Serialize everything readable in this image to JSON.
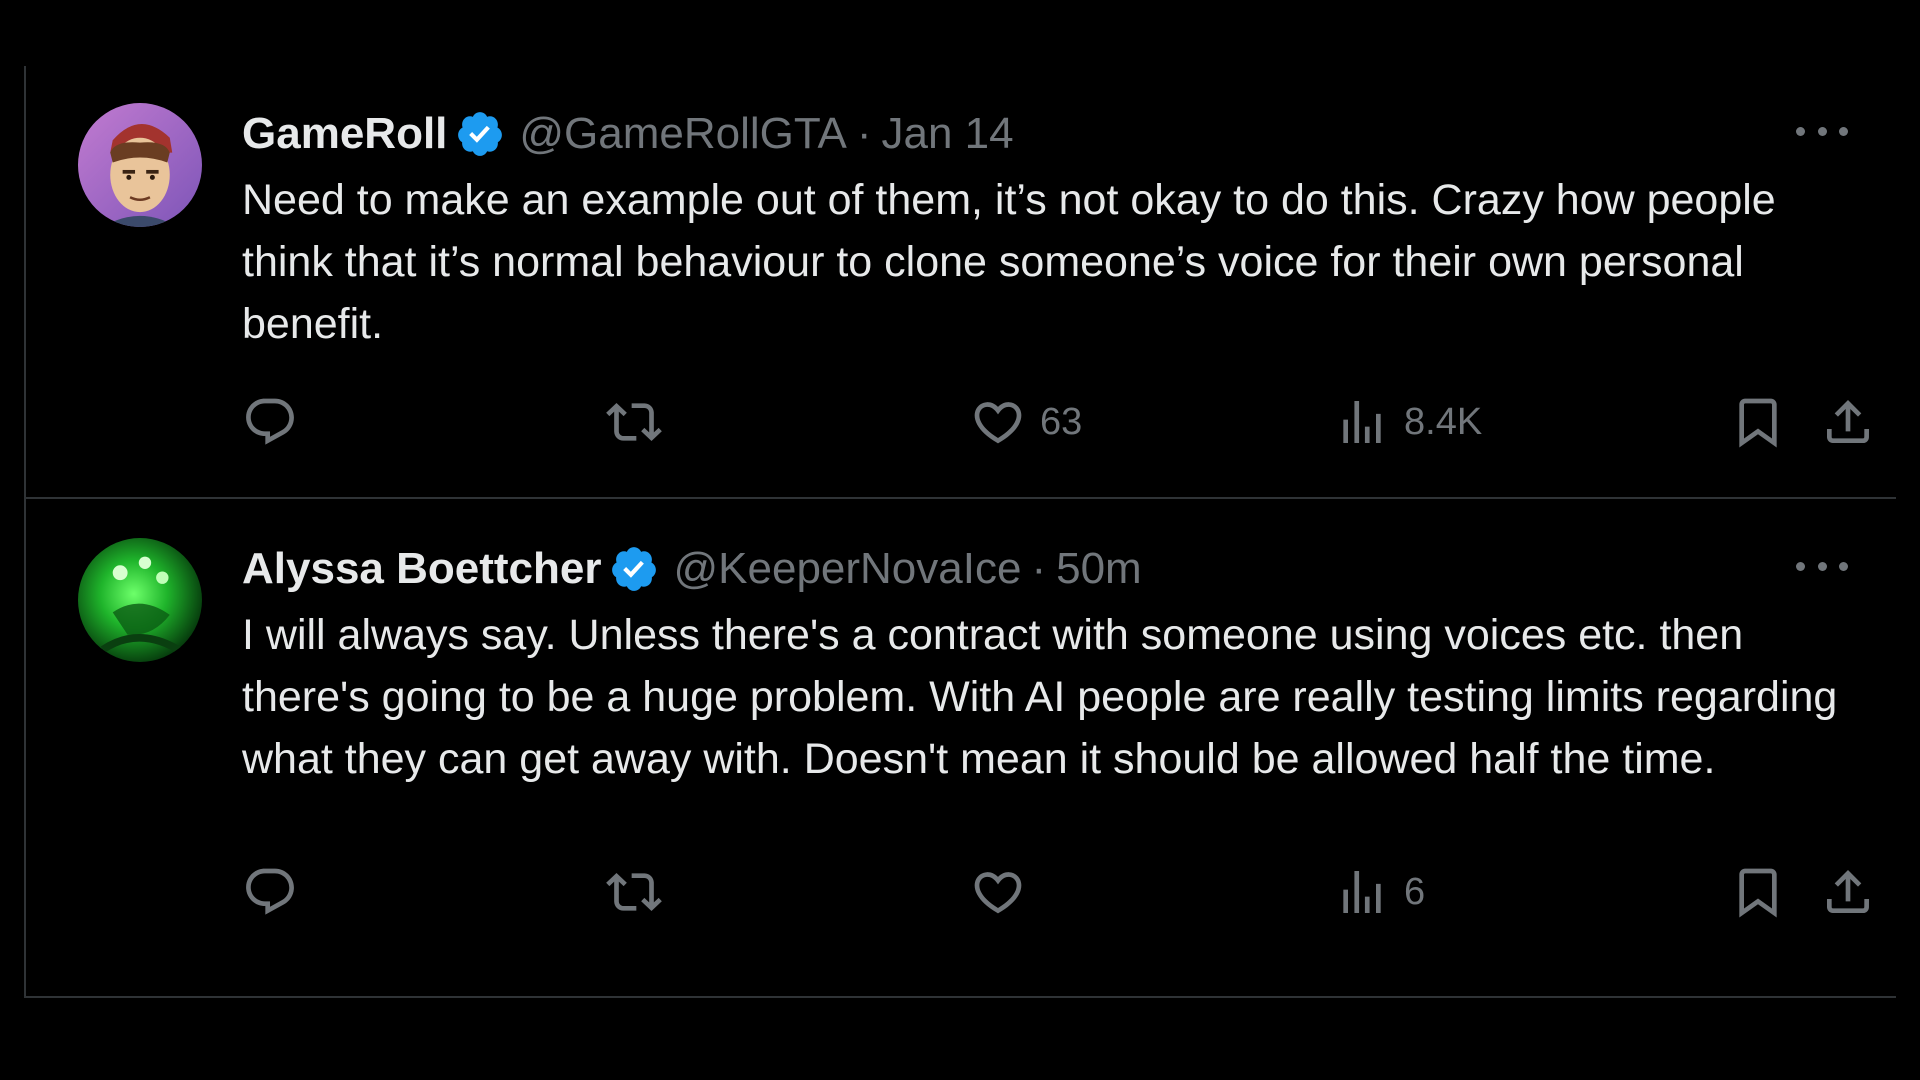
{
  "tweets": [
    {
      "name": "GameRoll",
      "verified": true,
      "handle": "@GameRollGTA",
      "separator": "·",
      "time": "Jan 14",
      "text": "Need to make an example out of them, it’s not okay to do this. Crazy how people think that it’s normal behaviour to clone someone’s voice for their own personal benefit.",
      "likes": "63",
      "views": "8.4K",
      "avatar_icon": "cartoon-man-avatar"
    },
    {
      "name": "Alyssa Boettcher",
      "verified": true,
      "handle": "@KeeperNovaIce",
      "separator": "·",
      "time": "50m",
      "text": "I will always say. Unless there's a contract with someone using voices etc. then there's going to be a huge problem. With AI people are really testing limits regarding what they can get away with. Doesn't mean it should be allowed half the time.",
      "likes": "",
      "views": "6",
      "avatar_icon": "green-glow-avatar"
    }
  ],
  "colors": {
    "background": "#000000",
    "primary_text": "#e7e9ea",
    "secondary_text": "#71767b",
    "verified_badge": "#1d9bf0",
    "divider": "#2f3336"
  }
}
